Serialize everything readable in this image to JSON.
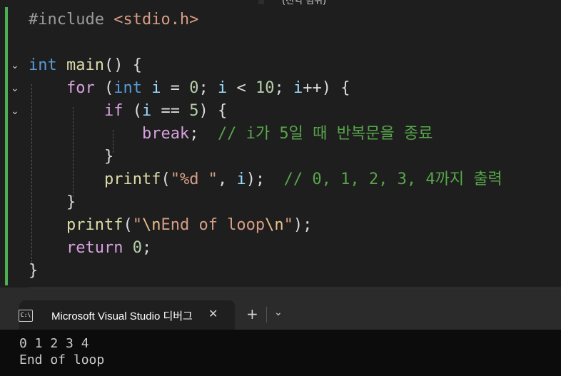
{
  "top_strip": {
    "hint": "(전역 범위)"
  },
  "code": {
    "include_directive": "#include",
    "include_header": "<stdio.h>",
    "line_main_type": "int",
    "line_main_name": "main",
    "line_main_rest": "() {",
    "for_kw": "for",
    "for_open": " (",
    "for_int": "int",
    "for_i1": " i",
    "for_eq": " = ",
    "for_zero": "0",
    "for_semi1": "; ",
    "for_i2": "i",
    "for_lt": " < ",
    "for_ten": "10",
    "for_semi2": "; ",
    "for_i3": "i",
    "for_tail": "++) {",
    "if_kw": "if",
    "if_open": " (",
    "if_i": "i",
    "if_eqeq": " == ",
    "if_five": "5",
    "if_tail": ") {",
    "break_kw": "break",
    "break_semi": ";  ",
    "break_comment": "// i가 5일 때 반복문을 종료",
    "close_if": "}",
    "printf1_fn": "printf",
    "printf1_open": "(",
    "printf1_str": "\"%d \"",
    "printf1_comma": ", ",
    "printf1_i": "i",
    "printf1_tail": ");  ",
    "printf1_comment": "// 0, 1, 2, 3, 4까지 출력",
    "close_for": "}",
    "printf2_fn": "printf",
    "printf2_open": "(",
    "printf2_q1": "\"",
    "printf2_esc1": "\\n",
    "printf2_text": "End of loop",
    "printf2_esc2": "\\n",
    "printf2_q2": "\"",
    "printf2_tail": ");",
    "return_kw": "return",
    "return_val": " 0",
    "return_semi": ";",
    "close_main": "}"
  },
  "debug_console": {
    "tab_title": "Microsoft Visual Studio 디버그",
    "tab_icon": "C:\\",
    "close_glyph": "✕",
    "add_glyph": "+",
    "dropdown_glyph": "⌄",
    "output_lines": [
      "0 1 2 3 4",
      "End of loop"
    ]
  },
  "colors": {
    "editor_bg": "#1e1e1e",
    "change_bar": "#4caf50",
    "terminal_bg": "#0c0c0c"
  }
}
